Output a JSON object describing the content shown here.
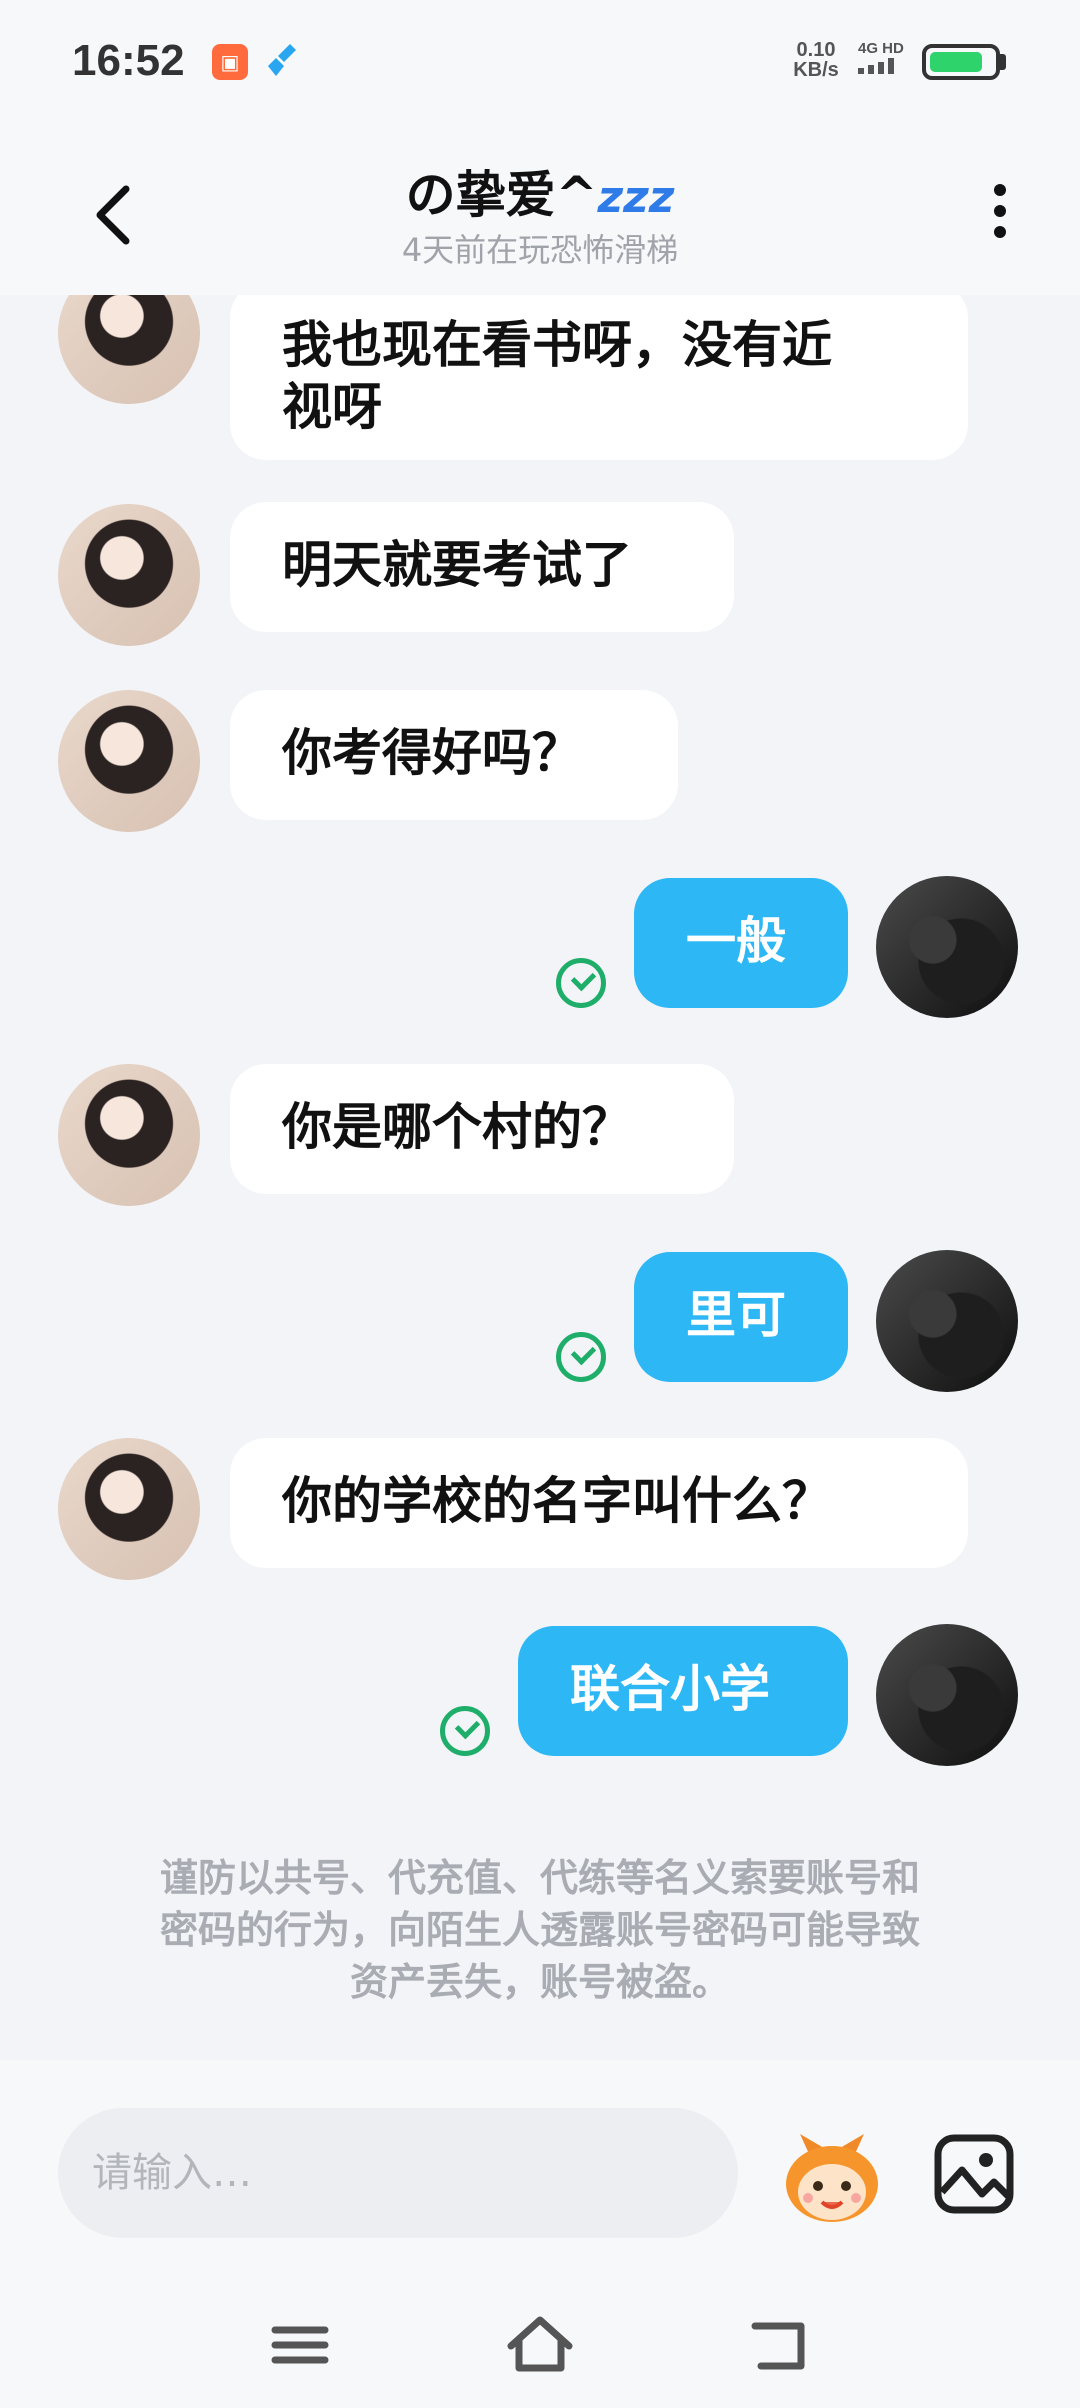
{
  "status_bar": {
    "time": "16:52",
    "net_speed_value": "0.10",
    "net_speed_unit": "KB/s",
    "network_label": "4G HD",
    "battery_percent": 85,
    "battery_color": "#2ed36b"
  },
  "header": {
    "title": "の挚爱^",
    "title_decoration": "zzz",
    "subtitle": "4天前在玩恐怖滑梯"
  },
  "messages": [
    {
      "sender": "her",
      "text_line1": "我也现在看书呀，没有近",
      "text_line2": "视呀"
    },
    {
      "sender": "her",
      "text": "明天就要考试了"
    },
    {
      "sender": "her",
      "text": "你考得好吗？"
    },
    {
      "sender": "me",
      "text": "一般",
      "status": "read"
    },
    {
      "sender": "her",
      "text": "你是哪个村的？"
    },
    {
      "sender": "me",
      "text": "里可",
      "status": "read"
    },
    {
      "sender": "her",
      "text": "你的学校的名字叫什么？"
    },
    {
      "sender": "me",
      "text": "联合小学",
      "status": "read"
    }
  ],
  "notice": {
    "line1": "谨防以共号、代充值、代练等名义索要账号和",
    "line2": "密码的行为，向陌生人透露账号密码可能导致",
    "line3": "资产丢失，账号被盗。"
  },
  "input": {
    "placeholder": "请输入…",
    "value": ""
  },
  "icons": {
    "back": "back-arrow-icon",
    "more": "more-vertical-icon",
    "emoji": "emoji-mascot-icon",
    "image": "image-icon",
    "menu": "menu-icon",
    "home": "home-icon",
    "return": "return-icon"
  },
  "colors": {
    "outgoing_bubble": "#2db7f5",
    "incoming_bubble": "#ffffff",
    "read_check": "#1fae6a",
    "background": "#f2f4f8"
  }
}
